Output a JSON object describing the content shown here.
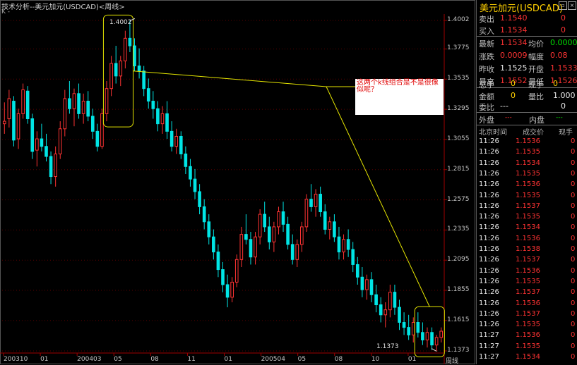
{
  "chart_panel": {
    "title": "技术分析--美元加元(USDCAD)<周线>",
    "kline_label": "K -",
    "note_text": "这两个k线组合是不是很像似呢？",
    "high_label": "1.4002",
    "low_label": "1.1373",
    "period_label": "周线"
  },
  "chart_data": {
    "type": "candlestick",
    "y_ticks": [
      "1.4002",
      "1.3775",
      "1.3535",
      "1.3295",
      "1.3055",
      "1.2815",
      "1.2575",
      "1.2335",
      "1.2095",
      "1.1855",
      "1.1615",
      "1.1373"
    ],
    "x_ticks": [
      "200310",
      "01",
      "200403",
      "05",
      "08",
      "11",
      "01",
      "200504",
      "05",
      "08",
      "10",
      "01"
    ],
    "ylim": [
      1.1373,
      1.4002
    ],
    "colors": {
      "up": "#ff3333",
      "down": "#00e5e5",
      "grid": "#5a0000",
      "annotation": "#e6e600"
    },
    "candles": [
      [
        1.318,
        1.335,
        1.31,
        1.32
      ],
      [
        1.322,
        1.345,
        1.315,
        1.338
      ],
      [
        1.336,
        1.34,
        1.3,
        1.305
      ],
      [
        1.306,
        1.33,
        1.298,
        1.326
      ],
      [
        1.326,
        1.35,
        1.322,
        1.345
      ],
      [
        1.344,
        1.348,
        1.318,
        1.322
      ],
      [
        1.322,
        1.326,
        1.29,
        1.296
      ],
      [
        1.297,
        1.312,
        1.284,
        1.306
      ],
      [
        1.306,
        1.318,
        1.296,
        1.3
      ],
      [
        1.3,
        1.31,
        1.288,
        1.292
      ],
      [
        1.292,
        1.296,
        1.27,
        1.276
      ],
      [
        1.276,
        1.3,
        1.268,
        1.294
      ],
      [
        1.294,
        1.32,
        1.29,
        1.314
      ],
      [
        1.314,
        1.345,
        1.308,
        1.338
      ],
      [
        1.338,
        1.352,
        1.326,
        1.33
      ],
      [
        1.33,
        1.346,
        1.316,
        1.342
      ],
      [
        1.342,
        1.35,
        1.322,
        1.326
      ],
      [
        1.326,
        1.342,
        1.318,
        1.336
      ],
      [
        1.336,
        1.344,
        1.32,
        1.324
      ],
      [
        1.324,
        1.33,
        1.306,
        1.312
      ],
      [
        1.312,
        1.318,
        1.296,
        1.3
      ],
      [
        1.3,
        1.33,
        1.298,
        1.326
      ],
      [
        1.326,
        1.352,
        1.32,
        1.346
      ],
      [
        1.346,
        1.372,
        1.34,
        1.366
      ],
      [
        1.366,
        1.38,
        1.35,
        1.356
      ],
      [
        1.356,
        1.372,
        1.348,
        1.368
      ],
      [
        1.368,
        1.392,
        1.362,
        1.386
      ],
      [
        1.386,
        1.4,
        1.375,
        1.38
      ],
      [
        1.38,
        1.386,
        1.36,
        1.364
      ],
      [
        1.364,
        1.378,
        1.354,
        1.36
      ],
      [
        1.36,
        1.364,
        1.34,
        1.346
      ],
      [
        1.346,
        1.354,
        1.33,
        1.336
      ],
      [
        1.336,
        1.344,
        1.322,
        1.33
      ],
      [
        1.33,
        1.336,
        1.312,
        1.318
      ],
      [
        1.318,
        1.332,
        1.31,
        1.326
      ],
      [
        1.326,
        1.336,
        1.306,
        1.312
      ],
      [
        1.312,
        1.32,
        1.296,
        1.3
      ],
      [
        1.3,
        1.314,
        1.294,
        1.308
      ],
      [
        1.308,
        1.312,
        1.29,
        1.294
      ],
      [
        1.294,
        1.3,
        1.278,
        1.284
      ],
      [
        1.284,
        1.29,
        1.268,
        1.274
      ],
      [
        1.274,
        1.282,
        1.258,
        1.264
      ],
      [
        1.264,
        1.27,
        1.246,
        1.252
      ],
      [
        1.252,
        1.258,
        1.234,
        1.24
      ],
      [
        1.24,
        1.246,
        1.222,
        1.228
      ],
      [
        1.228,
        1.234,
        1.21,
        1.216
      ],
      [
        1.216,
        1.222,
        1.196,
        1.202
      ],
      [
        1.202,
        1.208,
        1.184,
        1.19
      ],
      [
        1.19,
        1.198,
        1.172,
        1.18
      ],
      [
        1.18,
        1.196,
        1.176,
        1.192
      ],
      [
        1.192,
        1.214,
        1.188,
        1.21
      ],
      [
        1.21,
        1.236,
        1.204,
        1.23
      ],
      [
        1.23,
        1.246,
        1.222,
        1.226
      ],
      [
        1.226,
        1.232,
        1.206,
        1.212
      ],
      [
        1.212,
        1.232,
        1.206,
        1.228
      ],
      [
        1.228,
        1.25,
        1.222,
        1.246
      ],
      [
        1.246,
        1.256,
        1.232,
        1.236
      ],
      [
        1.236,
        1.244,
        1.218,
        1.224
      ],
      [
        1.224,
        1.24,
        1.216,
        1.236
      ],
      [
        1.236,
        1.252,
        1.23,
        1.248
      ],
      [
        1.248,
        1.256,
        1.232,
        1.238
      ],
      [
        1.238,
        1.244,
        1.218,
        1.222
      ],
      [
        1.222,
        1.23,
        1.206,
        1.21
      ],
      [
        1.21,
        1.226,
        1.204,
        1.222
      ],
      [
        1.222,
        1.24,
        1.216,
        1.236
      ],
      [
        1.236,
        1.262,
        1.232,
        1.258
      ],
      [
        1.258,
        1.27,
        1.248,
        1.252
      ],
      [
        1.252,
        1.266,
        1.244,
        1.262
      ],
      [
        1.262,
        1.268,
        1.244,
        1.248
      ],
      [
        1.248,
        1.254,
        1.23,
        1.234
      ],
      [
        1.234,
        1.244,
        1.226,
        1.24
      ],
      [
        1.24,
        1.246,
        1.224,
        1.228
      ],
      [
        1.228,
        1.236,
        1.21,
        1.216
      ],
      [
        1.216,
        1.23,
        1.21,
        1.226
      ],
      [
        1.226,
        1.234,
        1.212,
        1.218
      ],
      [
        1.218,
        1.224,
        1.2,
        1.206
      ],
      [
        1.206,
        1.212,
        1.19,
        1.196
      ],
      [
        1.196,
        1.204,
        1.18,
        1.186
      ],
      [
        1.186,
        1.198,
        1.178,
        1.194
      ],
      [
        1.194,
        1.2,
        1.176,
        1.182
      ],
      [
        1.182,
        1.19,
        1.168,
        1.174
      ],
      [
        1.174,
        1.18,
        1.16,
        1.166
      ],
      [
        1.166,
        1.176,
        1.156,
        1.17
      ],
      [
        1.17,
        1.19,
        1.164,
        1.184
      ],
      [
        1.184,
        1.19,
        1.166,
        1.172
      ],
      [
        1.172,
        1.178,
        1.154,
        1.16
      ],
      [
        1.16,
        1.168,
        1.15,
        1.156
      ],
      [
        1.156,
        1.166,
        1.146,
        1.15
      ],
      [
        1.15,
        1.164,
        1.144,
        1.16
      ],
      [
        1.16,
        1.168,
        1.148,
        1.152
      ],
      [
        1.152,
        1.16,
        1.142,
        1.146
      ],
      [
        1.146,
        1.156,
        1.14,
        1.152
      ],
      [
        1.152,
        1.156,
        1.138,
        1.142
      ],
      [
        1.142,
        1.15,
        1.137,
        1.148
      ],
      [
        1.148,
        1.156,
        1.144,
        1.153
      ]
    ],
    "annotation_boxes": [
      {
        "from": 22,
        "to": 27
      },
      {
        "from": 89,
        "to": 94
      }
    ]
  },
  "quote_panel": {
    "title": "美元加元(USDCAD)",
    "ask": {
      "label": "卖出",
      "value": "1.1540",
      "size": "0"
    },
    "bid": {
      "label": "买入",
      "value": "1.1534",
      "size": "0"
    },
    "stats": [
      {
        "l1": "最新",
        "v1": "1.1534",
        "c1": "red",
        "l2": "均价",
        "v2": "0.0000",
        "c2": "green"
      },
      {
        "l1": "涨跌",
        "v1": "0.0009",
        "c1": "red",
        "l2": "幅度",
        "v2": "0.08",
        "c2": "red"
      },
      {
        "l1": "昨收",
        "v1": "1.1525",
        "c1": "white",
        "l2": "开盘",
        "v2": "1.1533",
        "c2": "red"
      },
      {
        "l1": "最高",
        "v1": "1.1552",
        "c1": "red",
        "l2": "最低",
        "v2": "1.1526",
        "c2": "red"
      }
    ],
    "volume": [
      {
        "l1": "总手",
        "v1": "0",
        "c1": "yellow",
        "l2": "现手",
        "v2": "0",
        "c2": "yellow"
      },
      {
        "l1": "金额",
        "v1": "0",
        "c1": "yellow",
        "l2": "量比",
        "v2": "1.000",
        "c2": "white"
      }
    ],
    "weibi": {
      "label": "委比",
      "value": "---",
      "right": "0"
    },
    "outer_label": "外盘",
    "outer_value": "---",
    "inner_label": "内盘",
    "inner_value": "---",
    "trade_headers": [
      "北京时间",
      "成交价",
      "现手"
    ],
    "trades": [
      [
        "11:26",
        "1.1536",
        "0"
      ],
      [
        "11:26",
        "1.1535",
        "0"
      ],
      [
        "11:26",
        "1.1534",
        "0"
      ],
      [
        "11:26",
        "1.1535",
        "0"
      ],
      [
        "11:26",
        "1.1536",
        "0"
      ],
      [
        "11:26",
        "1.1535",
        "0"
      ],
      [
        "11:26",
        "1.1537",
        "0"
      ],
      [
        "11:26",
        "1.1535",
        "0"
      ],
      [
        "11:26",
        "1.1534",
        "0"
      ],
      [
        "11:26",
        "1.1536",
        "0"
      ],
      [
        "11:26",
        "1.1538",
        "0"
      ],
      [
        "11:26",
        "1.1537",
        "0"
      ],
      [
        "11:26",
        "1.1536",
        "0"
      ],
      [
        "11:26",
        "1.1535",
        "0"
      ],
      [
        "11:26",
        "1.1537",
        "0"
      ],
      [
        "11:26",
        "1.1536",
        "0"
      ],
      [
        "11:26",
        "1.1537",
        "0"
      ],
      [
        "11:26",
        "1.1535",
        "0"
      ],
      [
        "11:27",
        "1.1536",
        "0"
      ],
      [
        "11:27",
        "1.1535",
        "0"
      ],
      [
        "11:27",
        "1.1534",
        "0"
      ]
    ]
  }
}
